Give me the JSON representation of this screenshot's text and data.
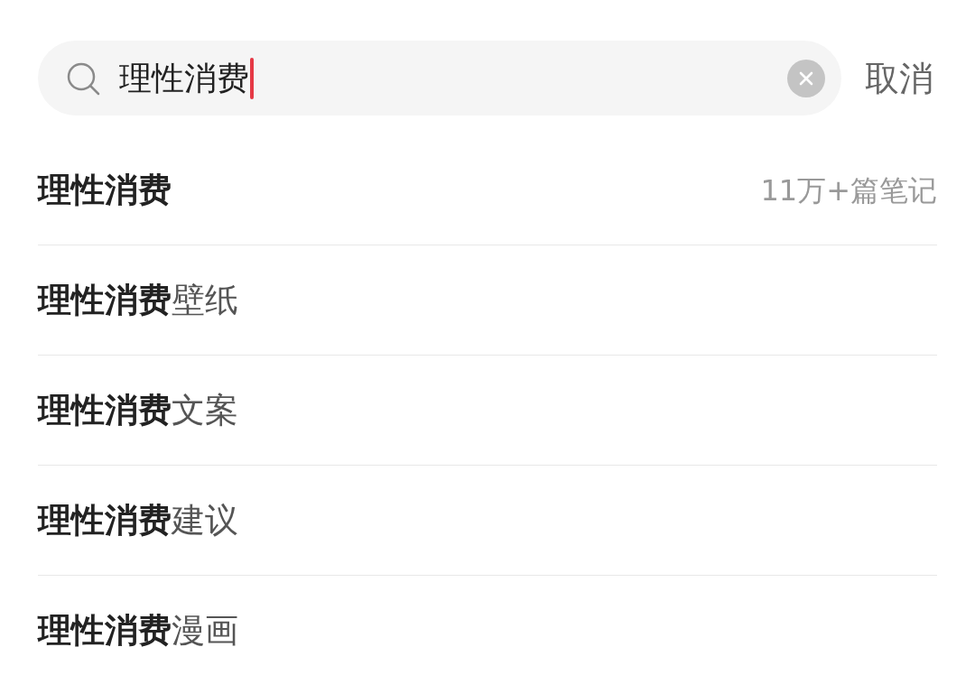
{
  "search": {
    "value": "理性消费",
    "cancel": "取消"
  },
  "suggestions": [
    {
      "kind": "exact",
      "text": "理性消费",
      "count": "11万+篇笔记"
    },
    {
      "kind": "suggestion",
      "text": "**理性消费**壁纸"
    },
    {
      "kind": "suggestion",
      "text": "**理性消费**文案"
    },
    {
      "kind": "suggestion",
      "text": "**理性消费**建议"
    },
    {
      "kind": "suggestion",
      "text": "**理性消费**漫画"
    }
  ]
}
